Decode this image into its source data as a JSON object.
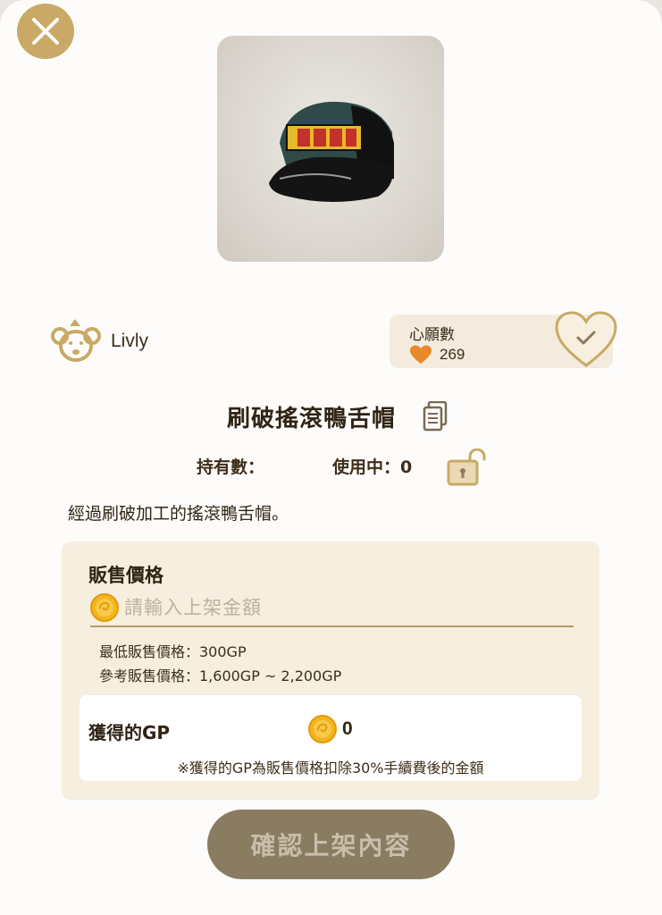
{
  "colors": {
    "accent_gold": "#c9a965",
    "panel_bg": "#f6eedf",
    "confirm_disabled": "#897c61",
    "heart_orange": "#e88a2c"
  },
  "header": {
    "close_icon": "close-icon"
  },
  "item": {
    "image_icon": "rock-cap-image",
    "title": "刷破搖滾鴨舌帽",
    "description": "經過刷破加工的搖滾鴨舌帽。",
    "owned_label": "持有數：",
    "using_label": "使用中：0"
  },
  "brand": {
    "name": "Livly"
  },
  "wishlist": {
    "label": "心願數",
    "count": "269"
  },
  "sale": {
    "heading": "販售價格",
    "input_placeholder": "請輸入上架金額",
    "input_value": "",
    "min_price": "最低販售價格：300GP",
    "ref_price": "參考販售價格：1,600GP ~ 2,200GP",
    "gp_label": "獲得的GP",
    "gp_value": "0",
    "gp_note": "※獲得的GP為販售價格扣除30%手續費後的金額"
  },
  "footer": {
    "confirm_label": "確認上架內容"
  }
}
